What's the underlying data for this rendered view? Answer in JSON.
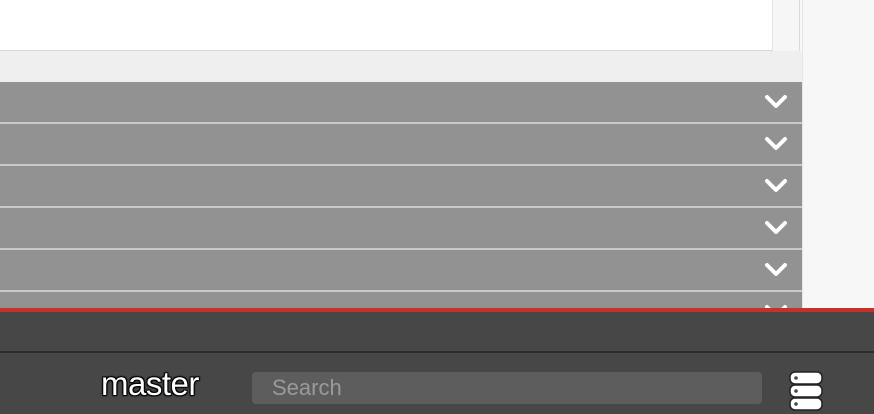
{
  "branch": {
    "label": "master"
  },
  "search": {
    "placeholder": "Search",
    "value": ""
  },
  "accordion": {
    "row_count": 6,
    "toggle_icon": "chevron-down-icon"
  },
  "toolbar": {
    "database_icon": "database-icon"
  },
  "colors": {
    "accent": "#c8302a",
    "bar_background": "#474747",
    "row_background": "#929292",
    "chevron": "#ffffff"
  }
}
